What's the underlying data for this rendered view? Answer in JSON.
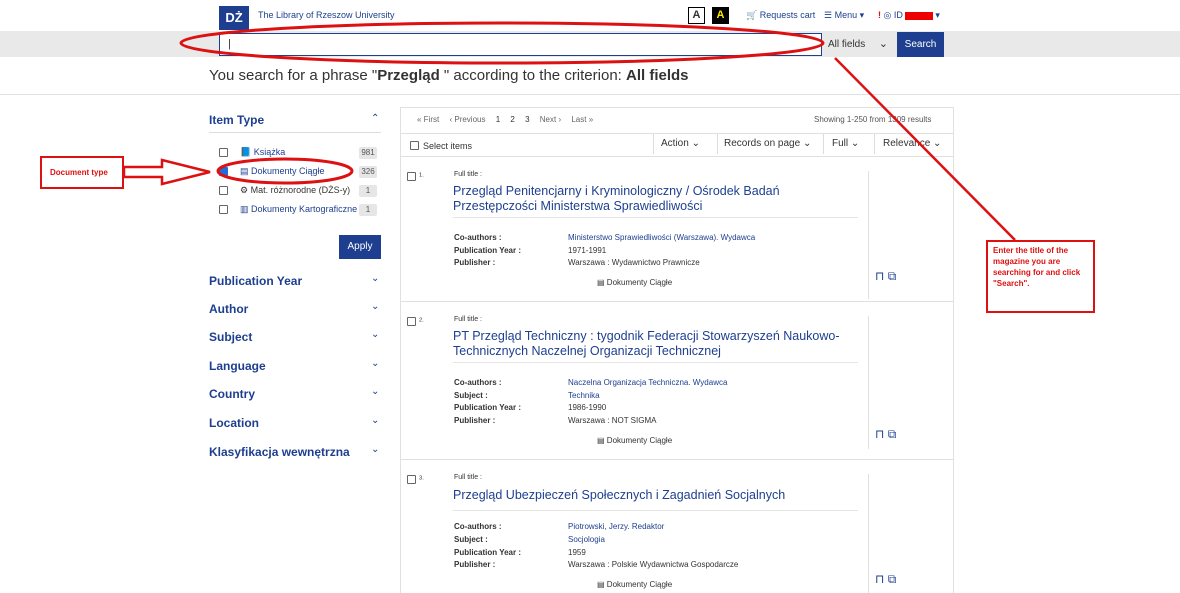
{
  "header": {
    "logo_text": "DŻ",
    "library_name": "The Library of Rzeszow University",
    "contrast_label": "A",
    "contrast_alt_label": "A",
    "cart_label": "Requests cart",
    "menu_label": "Menu",
    "id_label": "ID"
  },
  "search": {
    "value": "|",
    "fields_label": "All fields",
    "button_label": "Search"
  },
  "phrase": {
    "prefix": "You search for a phrase \"",
    "query": "Przegląd",
    "middle": " \" according to the criterion: ",
    "criterion": "All fields"
  },
  "facets": {
    "item_type": {
      "title": "Item Type",
      "items": [
        {
          "label": "Książka",
          "count": "981",
          "checked": false
        },
        {
          "label": "Dokumenty Ciągłe",
          "count": "326",
          "checked": true
        },
        {
          "label": "Mat. różnorodne (DŻS-y)",
          "count": "1",
          "checked": false
        },
        {
          "label": "Dokumenty Kartograficzne",
          "count": "1",
          "checked": false
        }
      ],
      "apply_label": "Apply"
    },
    "others": [
      "Publication Year",
      "Author",
      "Subject",
      "Language",
      "Country",
      "Location",
      "Klasyfikacja wewnętrzna"
    ]
  },
  "pager": {
    "first": "« First",
    "previous": "‹ Previous",
    "pages": [
      "1",
      "2",
      "3"
    ],
    "next": "Next ›",
    "last": "Last »",
    "showing": "Showing 1-250 from 1309 results"
  },
  "toolbar": {
    "select_items": "Select items",
    "action": "Action",
    "records_on_page": "Records on page",
    "full": "Full",
    "relevance": "Relevance"
  },
  "records": [
    {
      "num": "1.",
      "full_title_label": "Full title :",
      "title": "Przegląd Penitencjarny i Kryminologiczny / Ośrodek Badań Przestępczości Ministerstwa Sprawiedliwości",
      "meta": [
        {
          "key": "Co-authors :",
          "value": "Ministerstwo Sprawiedliwości (Warszawa). Wydawca",
          "link": true
        },
        {
          "key": "Publication Year :",
          "value": "1971-1991",
          "link": false
        },
        {
          "key": "Publisher :",
          "value": "Warszawa : Wydawnictwo Prawnicze",
          "link": false
        }
      ],
      "doc_type": "Dokumenty Ciągłe"
    },
    {
      "num": "2.",
      "full_title_label": "Full title :",
      "title": "PT Przegląd Techniczny : tygodnik Federacji Stowarzyszeń Naukowo-Technicznych Naczelnej Organizacji Technicznej",
      "meta": [
        {
          "key": "Co-authors :",
          "value": "Naczelna Organizacja Techniczna. Wydawca",
          "link": true
        },
        {
          "key": "Subject :",
          "value": "Technika",
          "link": true
        },
        {
          "key": "Publication Year :",
          "value": "1986-1990",
          "link": false
        },
        {
          "key": "Publisher :",
          "value": "Warszawa : NOT SIGMA",
          "link": false
        }
      ],
      "doc_type": "Dokumenty Ciągłe"
    },
    {
      "num": "3.",
      "full_title_label": "Full title :",
      "title": "Przegląd Ubezpieczeń Społecznych i Zagadnień Socjalnych",
      "meta": [
        {
          "key": "Co-authors :",
          "value": "Piotrowski, Jerzy. Redaktor",
          "link": true
        },
        {
          "key": "Subject :",
          "value": "Socjologia",
          "link": true
        },
        {
          "key": "Publication Year :",
          "value": "1959",
          "link": false
        },
        {
          "key": "Publisher :",
          "value": "Warszawa : Polskie Wydawnictwa Gospodarcze",
          "link": false
        }
      ],
      "doc_type": "Dokumenty Ciągłe"
    }
  ],
  "annotations": {
    "document_type": "Document type",
    "search_hint": "Enter the title of the magazine you are searching for and click \"Search\".",
    "color": "#dd1111"
  }
}
